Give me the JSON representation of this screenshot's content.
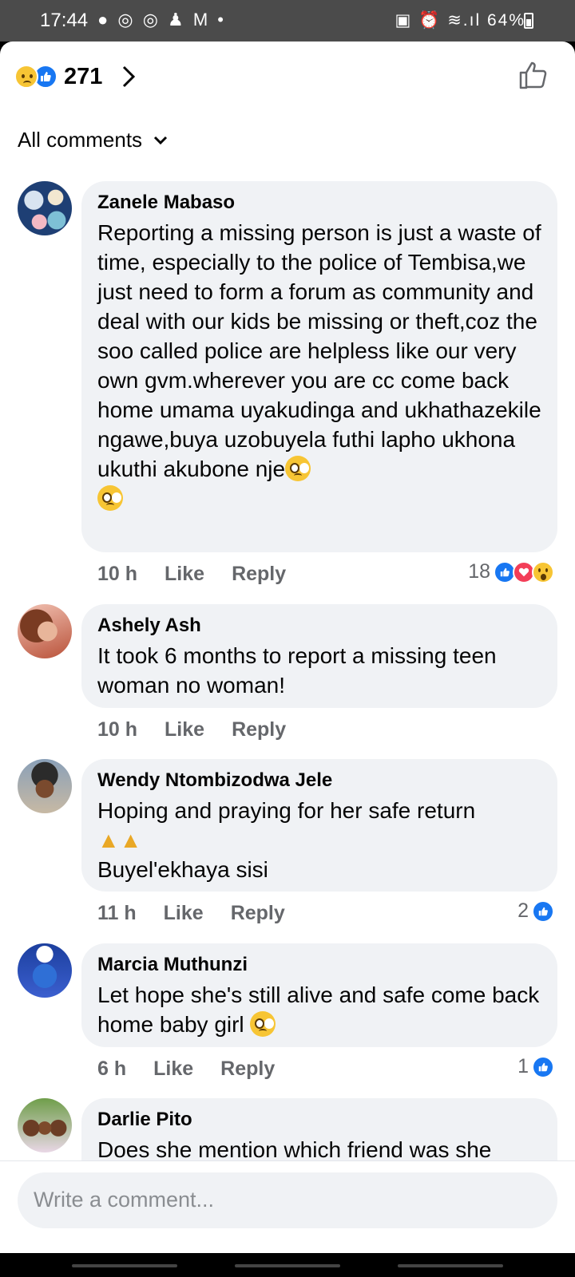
{
  "status": {
    "time": "17:44",
    "left_icons": "● ◎ ◎ ♟ M •",
    "right_icons": "▣ ⏰ ≋.ıl",
    "battery": "64%"
  },
  "header": {
    "reaction_count": "271"
  },
  "filter": {
    "label": "All comments"
  },
  "comments": [
    {
      "author": "Zanele Mabaso",
      "body": "Reporting a missing person is just a waste of time, especially to the police of Tembisa,we just need to form a forum as community and deal with our kids be missing or theft,coz the soo called police are helpless like our very own gvm.wherever you are cc come back home umama uyakudinga and ukhathazekile ngawe,buya uzobuyela futhi lapho ukhona ukuthi akubone nje",
      "time": "10 h",
      "like": "Like",
      "reply": "Reply",
      "reactions": "18"
    },
    {
      "author": "Ashely Ash",
      "body": "It took 6 months to report a missing teen woman no woman!",
      "time": "10 h",
      "like": "Like",
      "reply": "Reply"
    },
    {
      "author": "Wendy Ntombizodwa Jele",
      "body": "Hoping and praying for her safe return",
      "body2": "Buyel'ekhaya sisi",
      "time": "11 h",
      "like": "Like",
      "reply": "Reply",
      "reactions": "2"
    },
    {
      "author": "Marcia Muthunzi",
      "body": "Let hope she's still alive and safe come back home baby girl",
      "time": "6 h",
      "like": "Like",
      "reply": "Reply",
      "reactions": "1"
    },
    {
      "author": "Darlie Pito",
      "body": "Does she mention which friend was she"
    }
  ],
  "composer": {
    "placeholder": "Write a comment..."
  },
  "colors": {
    "accent": "#1877f2",
    "bubble": "#f0f2f5",
    "muted": "#65676b"
  },
  "icons": [
    "sad-emoji-icon",
    "like-icon",
    "chevron-right-icon",
    "thumbs-up-icon",
    "chevron-down-icon",
    "love-icon",
    "wow-icon",
    "pleading-face-icon",
    "praying-hands-icon",
    "relieved-face-icon"
  ]
}
